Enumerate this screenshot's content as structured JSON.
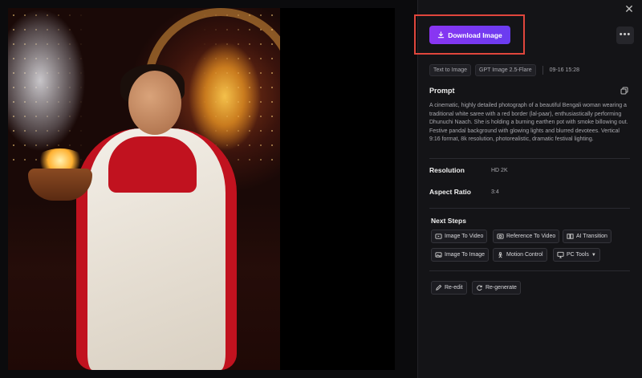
{
  "actions": {
    "download_label": "Download Image",
    "more_label": "•••",
    "close_label": "✕"
  },
  "tags": [
    "Text to Image",
    "GPT Image 2.5-Flare"
  ],
  "timestamp": "09-16 15:28",
  "prompt": {
    "title": "Prompt",
    "text": "A cinematic, highly detailed photograph of a beautiful Bengali woman wearing a traditional white saree with a red border (lal-paar), enthusiastically performing Dhunuchi Naach. She is holding a burning earthen pot with smoke billowing out. Festive pandal background with glowing lights and blurred devotees. Vertical 9:16 format, 8k resolution, photorealistic, dramatic festival lighting."
  },
  "meta": {
    "resolution_label": "Resolution",
    "resolution_value": "HD 2K",
    "aspect_label": "Aspect Ratio",
    "aspect_value": "3:4"
  },
  "next_steps": {
    "title": "Next Steps",
    "image_to_video": "Image To Video",
    "reference_to_video": "Reference To Video",
    "ai_transition": "AI Transition",
    "image_to_image": "Image To Image",
    "motion_control": "Motion Control",
    "pc_tools": "PC Tools"
  },
  "edit": {
    "re_edit": "Re-edit",
    "re_generate": "Re-generate"
  },
  "colors": {
    "accent_gradient_start": "#8a35f2",
    "accent_gradient_end": "#6a3cf0",
    "highlight_border": "#e0463c",
    "panel_bg": "#141417"
  },
  "icons": {
    "download": "download-icon",
    "copy": "copy-icon",
    "close": "close-icon",
    "more": "more-icon"
  }
}
